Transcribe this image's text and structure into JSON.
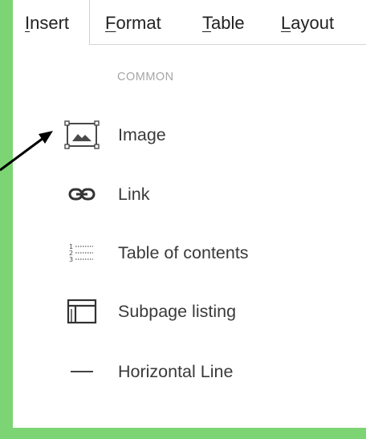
{
  "menubar": {
    "items": [
      {
        "mnemonic": "I",
        "rest": "nsert"
      },
      {
        "mnemonic": "F",
        "rest": "ormat"
      },
      {
        "mnemonic": "T",
        "rest": "able"
      },
      {
        "mnemonic": "L",
        "rest": "ayout"
      }
    ]
  },
  "insert_menu": {
    "section_heading": "COMMON",
    "items": [
      {
        "label": "Image",
        "icon": "image-icon"
      },
      {
        "label": "Link",
        "icon": "link-icon"
      },
      {
        "label": "Table of contents",
        "icon": "table-of-contents-icon"
      },
      {
        "label": "Subpage listing",
        "icon": "subpage-listing-icon"
      },
      {
        "label": "Horizontal Line",
        "icon": "horizontal-line-icon"
      }
    ]
  },
  "colors": {
    "background": "#7dd474",
    "panel": "#ffffff",
    "arrow": "#000000"
  }
}
